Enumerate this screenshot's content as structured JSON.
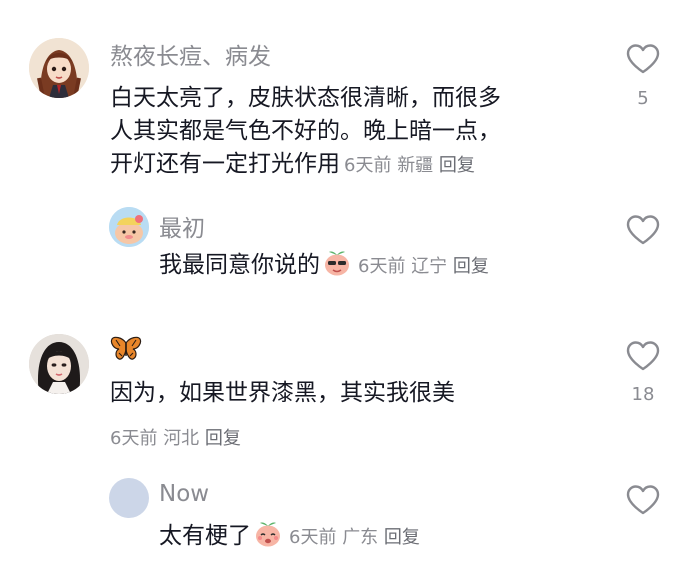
{
  "comments": [
    {
      "username": "熬夜长痘、病发",
      "text_lines": [
        "白天太亮了，皮肤状态很清晰，而很多",
        "人其实都是气色不好的。晚上暗一点，",
        "开灯还有一定打光作用"
      ],
      "time": "6天前",
      "location": "新疆",
      "reply_label": "回复",
      "like_count": "5",
      "replies": [
        {
          "username": "最初",
          "text": "我最同意你说的",
          "time": "6天前",
          "location": "辽宁",
          "reply_label": "回复"
        }
      ]
    },
    {
      "username": "",
      "username_icon": "butterfly-icon",
      "text": "因为，如果世界漆黑，其实我很美",
      "time": "6天前",
      "location": "河北",
      "reply_label": "回复",
      "like_count": "18",
      "replies": [
        {
          "username": "Now",
          "text": "太有梗了",
          "time": "6天前",
          "location": "广东",
          "reply_label": "回复"
        }
      ]
    }
  ],
  "colors": {
    "text": "#161823",
    "secondary": "#8a8b91",
    "heart_stroke": "#8a8b91"
  },
  "icons": {
    "like": "heart-outline-icon",
    "emoji": "peach-emoji-icon"
  }
}
